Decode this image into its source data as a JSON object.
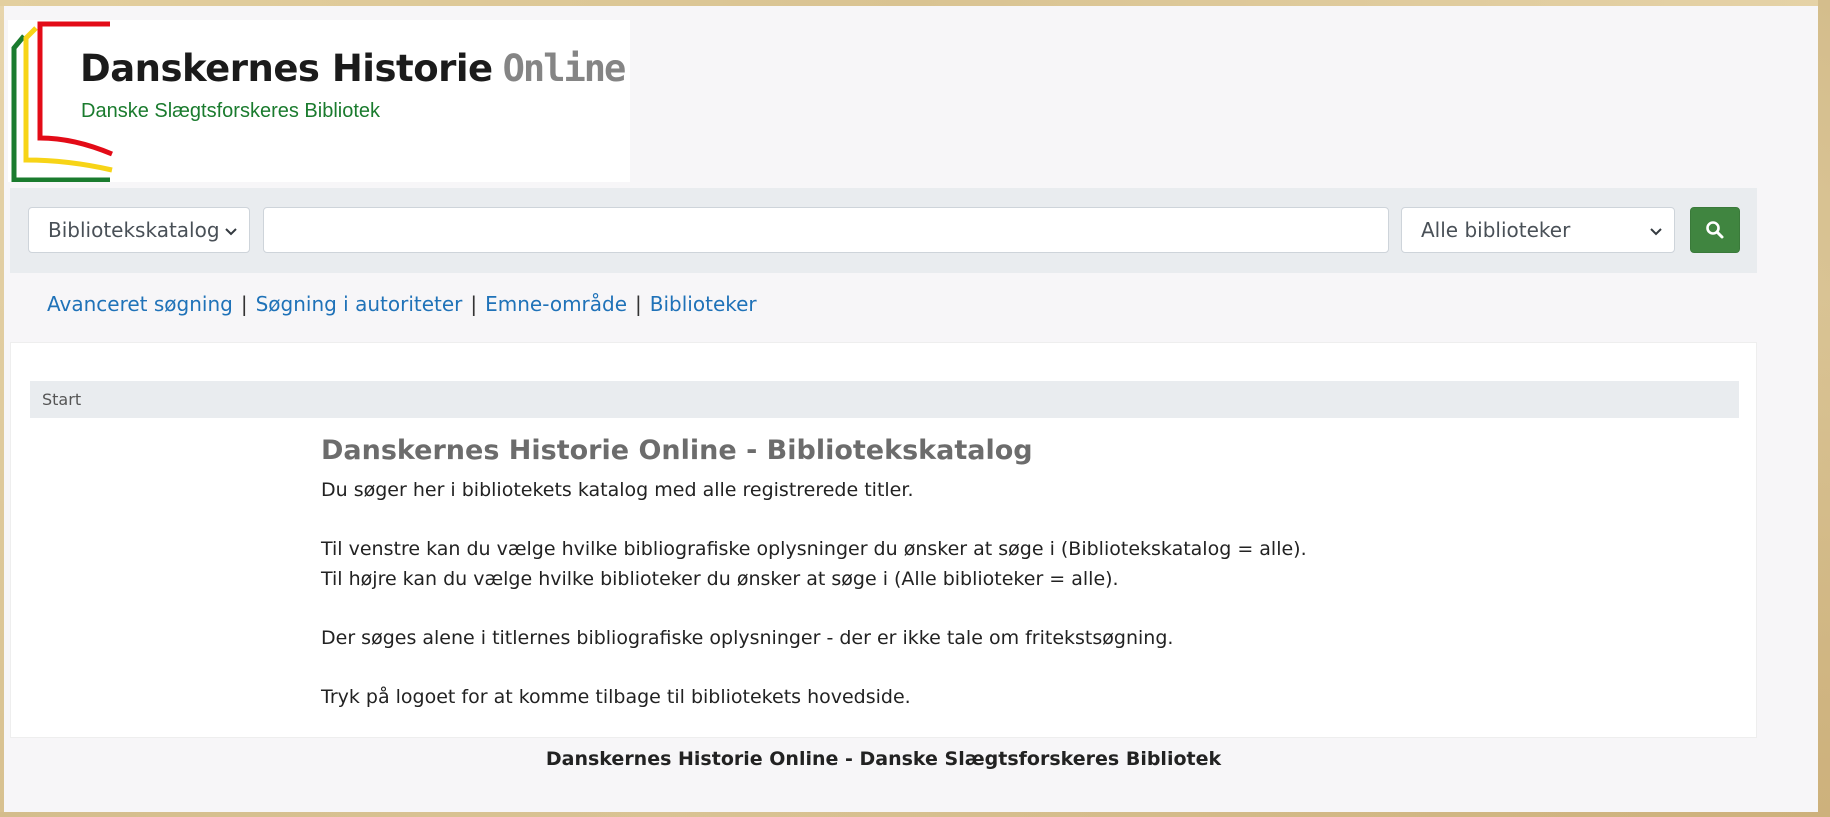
{
  "logo": {
    "title_main": "Danskernes Historie",
    "title_accent": "Online",
    "subtitle": "Danske Slægtsforskeres Bibliotek",
    "colors": {
      "red": "#e30b17",
      "yellow": "#f7d417",
      "green": "#1a7b2e"
    }
  },
  "search": {
    "index_selected": "Bibliotekskatalog",
    "query_value": "",
    "library_selected": "Alle biblioteker",
    "button_icon": "search-icon",
    "button_color": "#408540"
  },
  "nav_links": [
    {
      "label": "Avanceret søgning"
    },
    {
      "label": "Søgning i autoriteter"
    },
    {
      "label": "Emne-område"
    },
    {
      "label": "Biblioteker"
    }
  ],
  "nav_separator": "|",
  "breadcrumb": {
    "label": "Start"
  },
  "main": {
    "heading": "Danskernes Historie Online - Bibliotekskatalog",
    "paragraphs": [
      "Du søger her i bibliotekets katalog med alle registrerede titler.",
      "Til venstre kan du vælge hvilke bibliografiske oplysninger du ønsker at søge i (Bibliotekskatalog = alle).",
      "Til højre kan du vælge hvilke biblioteker du ønsker at søge i (Alle biblioteker = alle).",
      "Der søges alene i titlernes bibliografiske oplysninger - der er ikke tale om fritekstsøgning.",
      "Tryk på logoet for at komme tilbage til bibliotekets hovedside."
    ]
  },
  "footer": {
    "text": "Danskernes Historie Online - Danske Slægtsforskeres Bibliotek"
  }
}
